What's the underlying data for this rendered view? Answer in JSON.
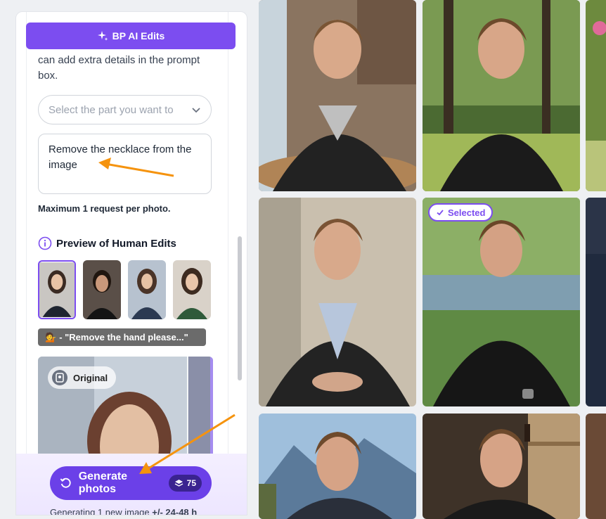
{
  "header": {
    "label": "BP AI Edits"
  },
  "intro_text": "can add extra details in the prompt box.",
  "select": {
    "placeholder": "Select the part you want to"
  },
  "prompt": {
    "value": "Remove the necklace from the image"
  },
  "limit_text": "Maximum 1 request per photo.",
  "preview": {
    "title": "Preview of Human Edits"
  },
  "tooltip": {
    "emoji": "💁",
    "text": "- \"Remove the hand please...\""
  },
  "compare": {
    "badge": "Original"
  },
  "generate": {
    "label": "Generate photos",
    "credits": "75"
  },
  "generating_note": {
    "prefix": "Generating 1 new image ",
    "eta": "+/- 24-48 h"
  },
  "gallery": {
    "selected_label": "Selected"
  },
  "colors": {
    "accent": "#7c4df0",
    "arrow": "#f5930e"
  }
}
